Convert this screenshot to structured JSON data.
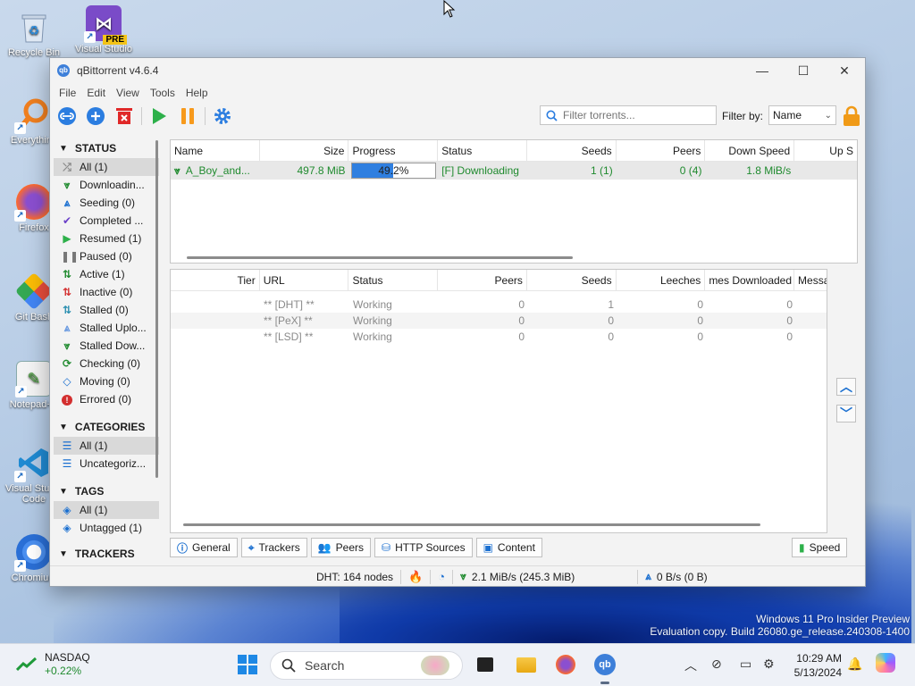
{
  "desktop": {
    "icons": [
      {
        "label": "Recycle Bin"
      },
      {
        "label": "Visual Studio",
        "badge": "PRE"
      },
      {
        "label": "Everything"
      },
      {
        "label": "Firefox"
      },
      {
        "label": "Git Bash"
      },
      {
        "label": "Notepad++"
      },
      {
        "label": "Visual Studio Code"
      },
      {
        "label": "Chromium"
      }
    ]
  },
  "window": {
    "title": "qBittorrent v4.6.4",
    "controls": {
      "minimize": "—",
      "maximize": "☐",
      "close": "✕"
    }
  },
  "menu": [
    "File",
    "Edit",
    "View",
    "Tools",
    "Help"
  ],
  "toolbar": {
    "filter_placeholder": "Filter torrents...",
    "filter_by_label": "Filter by:",
    "filter_by_value": "Name"
  },
  "sidebar": {
    "status_title": "STATUS",
    "status_items": [
      {
        "label": "All (1)"
      },
      {
        "label": "Downloadin..."
      },
      {
        "label": "Seeding (0)"
      },
      {
        "label": "Completed ..."
      },
      {
        "label": "Resumed (1)"
      },
      {
        "label": "Paused (0)"
      },
      {
        "label": "Active (1)"
      },
      {
        "label": "Inactive (0)"
      },
      {
        "label": "Stalled (0)"
      },
      {
        "label": "Stalled Uplo..."
      },
      {
        "label": "Stalled Dow..."
      },
      {
        "label": "Checking (0)"
      },
      {
        "label": "Moving (0)"
      },
      {
        "label": "Errored (0)"
      }
    ],
    "categories_title": "CATEGORIES",
    "category_items": [
      {
        "label": "All (1)"
      },
      {
        "label": "Uncategoriz..."
      }
    ],
    "tags_title": "TAGS",
    "tag_items": [
      {
        "label": "All (1)"
      },
      {
        "label": "Untagged (1)"
      }
    ],
    "trackers_title": "TRACKERS"
  },
  "torrents": {
    "columns": [
      "Name",
      "Size",
      "Progress",
      "Status",
      "Seeds",
      "Peers",
      "Down Speed",
      "Up S"
    ],
    "rows": [
      {
        "name": "A_Boy_and...",
        "size": "497.8 MiB",
        "progress_text": "49.2%",
        "progress": 0.492,
        "status": "[F] Downloading",
        "seeds": "1 (1)",
        "peers": "0 (4)",
        "down_speed": "1.8 MiB/s"
      }
    ]
  },
  "trackers": {
    "columns": [
      "Tier",
      "URL",
      "Status",
      "Peers",
      "Seeds",
      "Leeches",
      "mes Downloaded",
      "Messa"
    ],
    "rows": [
      {
        "tier": "",
        "url": "** [DHT] **",
        "status": "Working",
        "peers": "0",
        "seeds": "1",
        "leeches": "0",
        "downloaded": "0"
      },
      {
        "tier": "",
        "url": "** [PeX] **",
        "status": "Working",
        "peers": "0",
        "seeds": "0",
        "leeches": "0",
        "downloaded": "0"
      },
      {
        "tier": "",
        "url": "** [LSD] **",
        "status": "Working",
        "peers": "0",
        "seeds": "0",
        "leeches": "0",
        "downloaded": "0"
      }
    ]
  },
  "tabs": [
    "General",
    "Trackers",
    "Peers",
    "HTTP Sources",
    "Content"
  ],
  "speed_tab": "Speed",
  "statusbar": {
    "dht": "DHT: 164 nodes",
    "download": "2.1 MiB/s (245.3 MiB)",
    "upload": "0 B/s (0 B)"
  },
  "watermark": {
    "line1": "Windows 11 Pro Insider Preview",
    "line2": "Evaluation copy. Build 26080.ge_release.240308-1400"
  },
  "taskbar": {
    "stock_name": "NASDAQ",
    "stock_change": "+0.22%",
    "search_label": "Search",
    "time": "10:29 AM",
    "date": "5/13/2024"
  },
  "colors": {
    "accent": "#2f7fe0",
    "download_green": "#1f8a2e",
    "upload_blue": "#1a6fd0",
    "error_red": "#d32f2f"
  }
}
